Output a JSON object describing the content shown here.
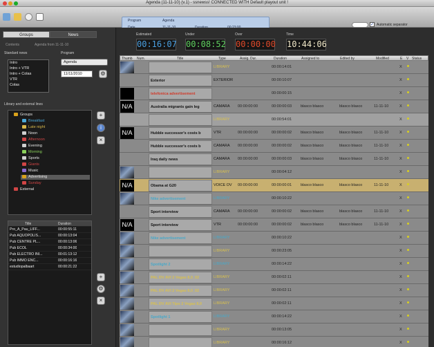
{
  "window": {
    "title": "Agenda (11-11-10) (v.1) - ssnewss! CONNECTED WITH Default playout unit !"
  },
  "infobox": {
    "program_label": "Program",
    "program_value": "Agenda",
    "date_label": "Date",
    "date_value": "11-11-10",
    "duration_label": "Duration",
    "duration_value": "00:23:00"
  },
  "toolbar": {
    "auto_separator_label": "Automatic separator",
    "auto_separator_checked": "✓"
  },
  "left": {
    "tabs": [
      "Groups",
      "News"
    ],
    "contents_label": "Contents",
    "agenda_from": "Agenda from 11-11-10",
    "standard_news_label": "Standard news",
    "standard_news": [
      "Intro",
      "Intro + VTR",
      "Intro + Colas",
      "VTR",
      "Colas"
    ],
    "program_label": "Program",
    "program_select": "Agenda",
    "program_date": "11/11/2010",
    "library_label": "Library and external lines",
    "tree": [
      {
        "label": "Groups",
        "color": "#e8e8e8",
        "icon": "#d9a21b"
      },
      {
        "label": "Breakfast",
        "color": "#4aa8d8",
        "icon": "#4aa8d8"
      },
      {
        "label": "Late night",
        "color": "#d9b84a",
        "icon": "#d9b84a"
      },
      {
        "label": "Noon",
        "color": "#e8e8e8",
        "icon": "#cfcfcf"
      },
      {
        "label": "Afternoon",
        "color": "#d04545",
        "icon": "#d04545"
      },
      {
        "label": "Evening",
        "color": "#e8e8e8",
        "icon": "#cfcfcf"
      },
      {
        "label": "Morning",
        "color": "#8ad05a",
        "icon": "#8ad05a"
      },
      {
        "label": "Sports",
        "color": "#e8e8e8",
        "icon": "#cfcfcf"
      },
      {
        "label": "Giants",
        "color": "#d04545",
        "icon": "#d04545"
      },
      {
        "label": "Music",
        "color": "#e8e8e8",
        "icon": "#8a6ad0"
      },
      {
        "label": "Advertising",
        "color": "#e8e8e8",
        "icon": "#d9a21b"
      },
      {
        "label": "Sunday",
        "color": "#d04545",
        "icon": "#d04545"
      },
      {
        "label": "External",
        "color": "#e8e8e8",
        "icon": "#d04545"
      }
    ],
    "table_headers": [
      "Title",
      "Duration"
    ],
    "table": [
      [
        "Pro_A_Pau_LIFF...",
        "00:00:55:11"
      ],
      [
        "Pub AQUOPOLIS...",
        "00:00:13:04"
      ],
      [
        "Pub CENTRE PL...",
        "00:00:13:06"
      ],
      [
        "Pub ECOL",
        "00:00:34:00"
      ],
      [
        "Pub ELECTRO INI...",
        "00:01:13:12"
      ],
      [
        "Pub IMMO ENC...",
        "00:00:16:16"
      ],
      [
        "estudiopalbaart",
        "00:00:21:22"
      ]
    ]
  },
  "clocks": [
    {
      "label": "Estimated",
      "value": "00:16:07",
      "color": "#4a9fe0"
    },
    {
      "label": "Under",
      "value": "00:08:52",
      "color": "#5fd05f"
    },
    {
      "label": "Over",
      "value": "00:00:00",
      "color": "#e04a2a"
    },
    {
      "label": "Time",
      "value": "10:44:06",
      "color": "#f0e8c8"
    }
  ],
  "columns": [
    "Thumb",
    "Num.",
    "Title",
    "Type",
    "Assig. Dur.",
    "Duration",
    "Assigned to",
    "Edited by",
    "Modified",
    "E",
    "V",
    "Status"
  ],
  "rows": [
    {
      "thumb": "img",
      "title": "",
      "title_color": "#d8c050",
      "type": "LIBRARY",
      "type_color": "#d8c050",
      "assig": "",
      "dur": "00:00:14:01",
      "assigned": "",
      "edited": "",
      "mod": "",
      "e": "X",
      "bg": "#8a8a8a"
    },
    {
      "thumb": "none",
      "title": "Exterior",
      "title_color": "#111",
      "type": "EXTERIOR",
      "type_color": "#111",
      "assig": "",
      "dur": "00:00:10:07",
      "assigned": "",
      "edited": "",
      "mod": "",
      "e": "X",
      "bg": "#8a8a8a"
    },
    {
      "thumb": "black",
      "title": "telefonica advertisement",
      "title_color": "#d03a2a",
      "type": "",
      "type_color": "#111",
      "assig": "",
      "dur": "00:00:00:15",
      "assigned": "",
      "edited": "",
      "mod": "",
      "e": "X",
      "bg": "#8a8a8a"
    },
    {
      "thumb": "na",
      "title": "Australia migrants gain leg",
      "title_color": "#111",
      "type": "CAMARA",
      "type_color": "#111",
      "assig": "00:00:00:00",
      "dur": "00:00:00:03",
      "assigned": "blasco blasco",
      "edited": "blasco blasco",
      "mod": "11-11-10",
      "e": "X",
      "bg": "#8a8a8a"
    },
    {
      "thumb": "none",
      "title": "",
      "title_color": "#d8c050",
      "type": "LIBRARY",
      "type_color": "#d8c050",
      "assig": "",
      "dur": "00:00:54:01",
      "assigned": "",
      "edited": "",
      "mod": "",
      "e": "X",
      "bg": "#a0a0a0"
    },
    {
      "thumb": "na",
      "title": "Hubble successor's costs b",
      "title_color": "#111",
      "type": "VTR",
      "type_color": "#111",
      "assig": "00:00:00:00",
      "dur": "00:00:00:02",
      "assigned": "blasco blasco",
      "edited": "blasco blasco",
      "mod": "11-11-10",
      "e": "X",
      "bg": "#8a8a8a"
    },
    {
      "thumb": "none",
      "title": "Hubble successor's costs b",
      "title_color": "#111",
      "type": "CAMARA",
      "type_color": "#111",
      "assig": "00:00:00:00",
      "dur": "00:00:00:02",
      "assigned": "blasco blasco",
      "edited": "blasco blasco",
      "mod": "11-11-10",
      "e": "X",
      "bg": "#8a8a8a"
    },
    {
      "thumb": "none",
      "title": "Iraq daily news",
      "title_color": "#111",
      "type": "CAMARA",
      "type_color": "#111",
      "assig": "00:00:00:00",
      "dur": "00:00:00:03",
      "assigned": "blasco blasco",
      "edited": "blasco blasco",
      "mod": "11-11-10",
      "e": "X",
      "bg": "#8a8a8a"
    },
    {
      "thumb": "img",
      "title": "",
      "title_color": "#d8c050",
      "type": "LIBRARY",
      "type_color": "#d8c050",
      "assig": "",
      "dur": "00:00:04:12",
      "assigned": "",
      "edited": "",
      "mod": "",
      "e": "X",
      "bg": "#8a8a8a"
    },
    {
      "thumb": "na",
      "title": "Obama at G20",
      "title_color": "#111",
      "type": "VOICE OV",
      "type_color": "#111",
      "assig": "00:00:00:00",
      "dur": "00:00:00:01",
      "assigned": "blasco blasco",
      "edited": "blasco blasco",
      "mod": "11-11-10",
      "e": "X",
      "bg": "#c8b070"
    },
    {
      "thumb": "img",
      "title": "Nike advertisement",
      "title_color": "#4aa8c8",
      "type": "LIBRARY",
      "type_color": "#4aa8c8",
      "assig": "",
      "dur": "00:00:10:22",
      "assigned": "",
      "edited": "",
      "mod": "",
      "e": "X",
      "bg": "#8a8a8a"
    },
    {
      "thumb": "none",
      "title": "Sport interview",
      "title_color": "#111",
      "type": "CAMARA",
      "type_color": "#111",
      "assig": "00:00:00:00",
      "dur": "00:00:00:02",
      "assigned": "blasco blasco",
      "edited": "blasco blasco",
      "mod": "11-11-10",
      "e": "X",
      "bg": "#8a8a8a"
    },
    {
      "thumb": "na",
      "title": "Sport interview",
      "title_color": "#111",
      "type": "VTR",
      "type_color": "#111",
      "assig": "00:00:00:00",
      "dur": "00:00:00:02",
      "assigned": "blasco blasco",
      "edited": "blasco blasco",
      "mod": "11-11-10",
      "e": "X",
      "bg": "#8a8a8a"
    },
    {
      "thumb": "img",
      "title": "Nike advertisement",
      "title_color": "#4aa8c8",
      "type": "LIBRARY",
      "type_color": "#4aa8c8",
      "assig": "",
      "dur": "00:00:10:22",
      "assigned": "",
      "edited": "",
      "mod": "",
      "e": "X",
      "bg": "#8a8a8a"
    },
    {
      "thumb": "img",
      "title": "",
      "title_color": "#d8c050",
      "type": "LIBRARY",
      "type_color": "#d8c050",
      "assig": "",
      "dur": "00:00:23:05",
      "assigned": "",
      "edited": "",
      "mod": "",
      "e": "X",
      "bg": "#8a8a8a"
    },
    {
      "thumb": "img",
      "title": "Spotlight 2",
      "title_color": "#4aa8c8",
      "type": "LIBRARY",
      "type_color": "#4aa8c8",
      "assig": "",
      "dur": "00:00:14:22",
      "assigned": "",
      "edited": "",
      "mod": "",
      "e": "X",
      "bg": "#8a8a8a"
    },
    {
      "thumb": "img",
      "title": "PAL DV AVI 2 Vegas 8,0_02",
      "title_color": "#d8c050",
      "type": "LIBRARY",
      "type_color": "#d8c050",
      "assig": "",
      "dur": "00:00:02:11",
      "assigned": "",
      "edited": "",
      "mod": "",
      "e": "X",
      "bg": "#8a8a8a"
    },
    {
      "thumb": "img",
      "title": "PAL DV AVI 2 Vegas 8,0_02",
      "title_color": "#d8c050",
      "type": "LIBRARY",
      "type_color": "#d8c050",
      "assig": "",
      "dur": "00:00:02:11",
      "assigned": "",
      "edited": "",
      "mod": "",
      "e": "X",
      "bg": "#8a8a8a"
    },
    {
      "thumb": "img",
      "title": "PAL DV AVI Tipo 2 Vegas 8,0",
      "title_color": "#d8c050",
      "type": "LIBRARY",
      "type_color": "#d8c050",
      "assig": "",
      "dur": "00:00:02:11",
      "assigned": "",
      "edited": "",
      "mod": "",
      "e": "X",
      "bg": "#8a8a8a"
    },
    {
      "thumb": "img",
      "title": "Spotlight 1",
      "title_color": "#4aa8c8",
      "type": "LIBRARY",
      "type_color": "#4aa8c8",
      "assig": "",
      "dur": "00:00:14:22",
      "assigned": "",
      "edited": "",
      "mod": "",
      "e": "X",
      "bg": "#8a8a8a"
    },
    {
      "thumb": "img",
      "title": "",
      "title_color": "#d8c050",
      "type": "LIBRARY",
      "type_color": "#d8c050",
      "assig": "",
      "dur": "00:00:13:05",
      "assigned": "",
      "edited": "",
      "mod": "",
      "e": "X",
      "bg": "#8a8a8a"
    },
    {
      "thumb": "img",
      "title": "",
      "title_color": "#d8c050",
      "type": "LIBRARY",
      "type_color": "#d8c050",
      "assig": "",
      "dur": "00:00:16:12",
      "assigned": "",
      "edited": "",
      "mod": "",
      "e": "X",
      "bg": "#8a8a8a"
    },
    {
      "thumb": "img",
      "title": "",
      "title_color": "#d8c050",
      "type": "LIBRARY",
      "type_color": "#d8c050",
      "assig": "",
      "dur": "00:00:21:22",
      "assigned": "",
      "edited": "",
      "mod": "",
      "e": "X",
      "bg": "#8a8a8a"
    }
  ]
}
